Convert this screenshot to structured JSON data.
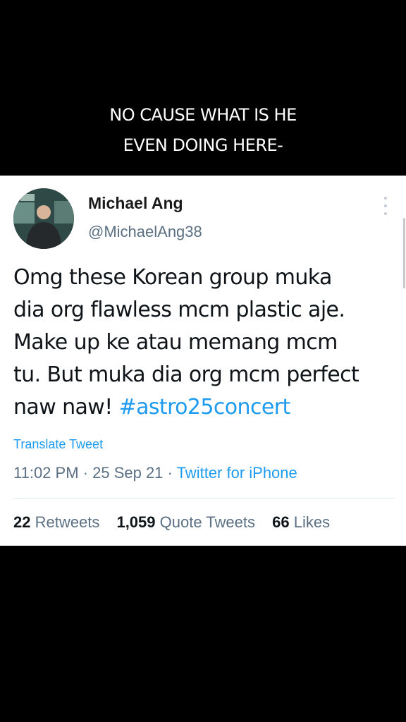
{
  "caption": {
    "line1": "NO CAUSE WHAT IS HE",
    "line2": "EVEN DOING HERE-"
  },
  "tweet": {
    "name": "Michael Ang",
    "handle": "@MichaelAng38",
    "text_lines": [
      "Omg these Korean group muka",
      "dia org flawless mcm plastic aje.",
      "Make up ke atau memang mcm",
      "tu. But muka dia org mcm perfect",
      "naw naw! "
    ],
    "hashtag": "#astro25concert",
    "translate_label": "Translate Tweet",
    "time": "11:02 PM",
    "date": "25 Sep 21",
    "separator": " · ",
    "source": "Twitter for iPhone",
    "retweets_count": "22",
    "retweets_label": "Retweets",
    "quote_count": "1,059",
    "quote_label": "Quote Tweets",
    "likes_count": "66",
    "likes_label": "Likes"
  },
  "colors": {
    "link": "#1d9bf0",
    "secondary_text": "#5b7083"
  },
  "icons": {
    "more": "more-vertical-icon"
  }
}
